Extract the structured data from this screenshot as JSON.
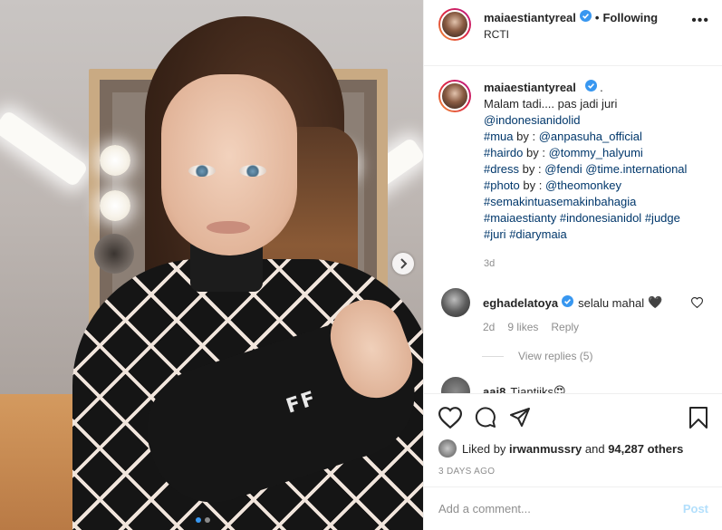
{
  "post": {
    "username": "maiaestiantyreal",
    "verified": true,
    "follow_separator": "•",
    "follow_status": "Following",
    "location": "RCTI",
    "more_label": "•••"
  },
  "caption": {
    "username": "maiaestiantyreal",
    "lines": [
      ".",
      "Malam tadi.... pas jadi juri",
      "@indonesianidolid",
      "#mua by : @anpasuha_official",
      "#hairdo by : @tommy_halyumi",
      "#dress by : @fendi @time.international",
      "#photo by : @theomonkey",
      "#semakintuasemakinbahagia",
      "#maiaestianty #indonesianidol #judge",
      "#juri #diarymaia"
    ],
    "segments": {
      "dot": ".",
      "l1": "Malam tadi.... pas jadi juri",
      "l2_tag": "@indonesianidolid",
      "l3_pre": "#mua",
      "l3_mid": " by : ",
      "l3_tag": "@anpasuha_official",
      "l4_pre": "#hairdo",
      "l4_mid": " by : ",
      "l4_tag": "@tommy_halyumi",
      "l5_pre": "#dress",
      "l5_mid": " by : ",
      "l5_tag1": "@fendi",
      "l5_sp": " ",
      "l5_tag2": "@time.international",
      "l6_pre": "#photo",
      "l6_mid": " by : ",
      "l6_tag": "@theomonkey",
      "l7_tag": "#semakintuasemakinbahagia",
      "l8_tag1": "#maiaestianty",
      "l8_tag2": "#indonesianidol",
      "l8_tag3": "#judge",
      "l9_tag1": "#juri",
      "l9_tag2": "#diarymaia"
    },
    "time": "3d"
  },
  "comments": [
    {
      "username": "eghadelatoya",
      "verified": true,
      "text": "selalu mahal",
      "emoji": "🖤",
      "time": "2d",
      "likes": "9 likes",
      "reply": "Reply",
      "view_replies": "View replies (5)"
    },
    {
      "username": "aai8",
      "text": "Tjantiiks",
      "emoji": "😍"
    }
  ],
  "actions": {
    "liked_by_prefix": "Liked by",
    "liked_by_user": "irwanmussry",
    "liked_by_and": "and",
    "liked_by_others": "94,287 others",
    "date": "3 DAYS AGO"
  },
  "add_comment": {
    "placeholder": "Add a comment...",
    "post_label": "Post"
  },
  "photo": {
    "brand_text": "FF",
    "carousel_dots": 2,
    "active_dot": 1
  },
  "colors": {
    "link": "#00376b",
    "verified": "#3897f0",
    "muted": "#8e8e8e",
    "post_disabled": "#b2dffc"
  },
  "icons": {
    "verified": "verified-badge-icon",
    "next": "chevron-right-icon",
    "heart": "heart-icon",
    "comment": "comment-icon",
    "share": "share-icon",
    "save": "bookmark-icon",
    "more": "more-icon"
  }
}
